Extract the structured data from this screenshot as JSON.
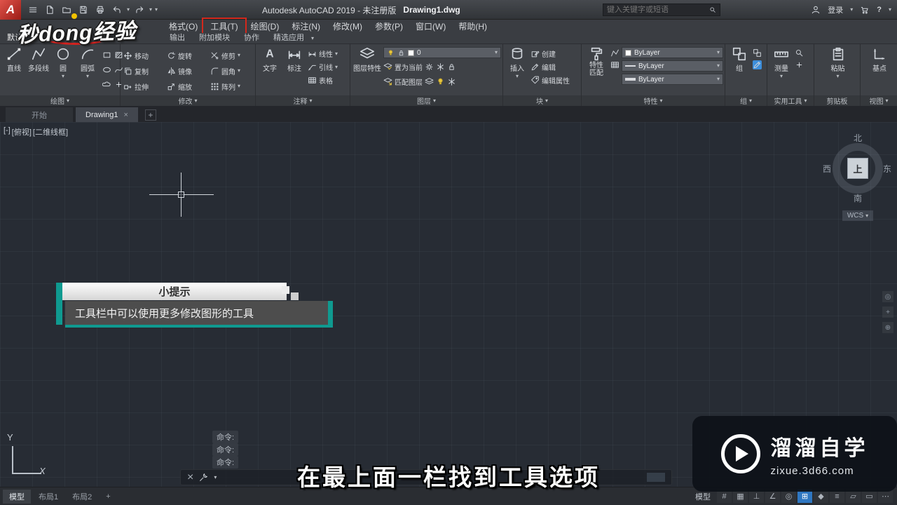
{
  "colors": {
    "highlight_red": "#d3281c",
    "accent_teal": "#0f9a90",
    "statusbar_blue": "#2f77c2",
    "canvas_bg": "#272c34"
  },
  "watermark": {
    "text": "秒dong经验"
  },
  "titlebar": {
    "app_title": "Autodesk AutoCAD 2019 - 未注册版",
    "doc_title": "Drawing1.dwg",
    "search_placeholder": "键入关键字或短语",
    "login": "登录"
  },
  "menubar": {
    "items": [
      "格式(O)",
      "工具(T)",
      "绘图(D)",
      "标注(N)",
      "修改(M)",
      "参数(P)",
      "窗口(W)",
      "帮助(H)"
    ]
  },
  "ribbon_tabs": {
    "default": "默认",
    "items": [
      "输出",
      "附加模块",
      "协作",
      "精选应用"
    ]
  },
  "ribbon": {
    "draw": {
      "label": "绘图",
      "line": "直线",
      "polyline": "多段线",
      "circle": "圆",
      "arc": "圆弧"
    },
    "modify": {
      "label": "修改",
      "move": "移动",
      "rotate": "旋转",
      "trim": "修剪",
      "copy": "复制",
      "mirror": "镜像",
      "fillet": "圆角",
      "stretch": "拉伸",
      "scale": "缩放",
      "array": "阵列"
    },
    "annotation": {
      "label": "注释",
      "text": "文字",
      "dimension": "标注",
      "linear": "线性",
      "leader": "引线",
      "table": "表格"
    },
    "layers": {
      "label": "图层",
      "properties": "图层特性",
      "current_layer": "0",
      "set_current": "置为当前",
      "match_layer": "匹配图层"
    },
    "block": {
      "label": "块",
      "insert": "插入",
      "create": "创建",
      "edit": "编辑",
      "edit_attribute": "编辑属性"
    },
    "properties": {
      "label": "特性",
      "match_line1": "特性",
      "match_line2": "匹配",
      "color": "ByLayer",
      "linetype": "ByLayer",
      "lineweight": "ByLayer"
    },
    "groups": {
      "label": "组",
      "group": "组"
    },
    "utilities": {
      "label": "实用工具",
      "measure": "测量"
    },
    "clipboard": {
      "label": "剪贴板",
      "paste": "粘贴"
    },
    "view": {
      "label": "视图",
      "base": "基点"
    }
  },
  "file_tabs": {
    "start": "开始",
    "drawing": "Drawing1",
    "add": "+"
  },
  "viewport": {
    "controls": [
      "[-]",
      "[俯视]",
      "[二维线框]"
    ]
  },
  "viewcube": {
    "north": "北",
    "south": "南",
    "east": "东",
    "west": "西",
    "top": "上",
    "wcs": "WCS"
  },
  "tip": {
    "title": "小提示",
    "body": "工具栏中可以使用更多修改图形的工具"
  },
  "ucs": {
    "x_label": "X",
    "y_label": "Y"
  },
  "command": {
    "prompt": "命令:"
  },
  "status_tabs": {
    "model": "模型",
    "layout1": "布局1",
    "layout2": "布局2",
    "add": "+"
  },
  "statusbar": {
    "model_label": "模型",
    "icon_glyphs": [
      "#",
      "▦",
      "⊥",
      "∠",
      "◎",
      "⊞",
      "◆",
      "≡",
      "▱",
      "▭",
      "⋯"
    ]
  },
  "subtitle": {
    "text": "在最上面一栏找到工具选项"
  },
  "brand": {
    "name": "溜溜自学",
    "url": "zixue.3d66.com"
  }
}
